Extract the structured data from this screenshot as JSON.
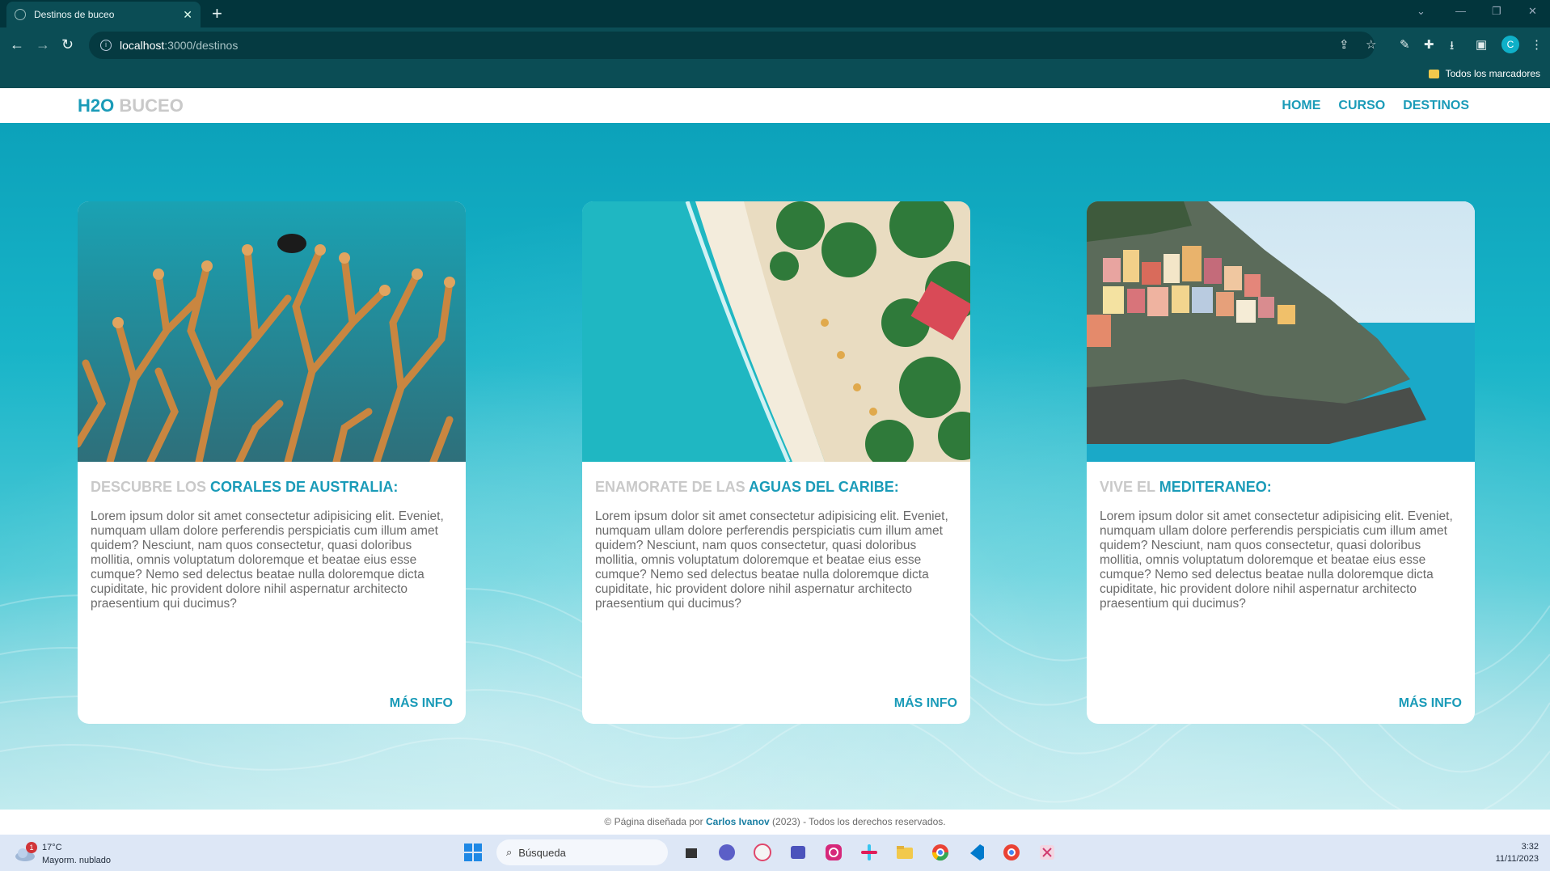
{
  "browser": {
    "tab_title": "Destinos de buceo",
    "new_tab": "+",
    "url_host": "localhost",
    "url_path": ":3000/destinos",
    "bookmarks_folder": "Todos los marcadores",
    "profile_initial": "C"
  },
  "site": {
    "logo_primary": "H2O",
    "logo_secondary": "BUCEO",
    "nav": [
      {
        "label": "HOME"
      },
      {
        "label": "CURSO"
      },
      {
        "label": "DESTINOS"
      }
    ],
    "cards": [
      {
        "heading_gray": "DESCUBRE LOS",
        "heading_teal": "CORALES DE AUSTRALIA:",
        "text": "Lorem ipsum dolor sit amet consectetur adipisicing elit. Eveniet, numquam ullam dolore perferendis perspiciatis cum illum amet quidem? Nesciunt, nam quos consectetur, quasi doloribus mollitia, omnis voluptatum doloremque et beatae eius esse cumque? Nemo sed delectus beatae nulla doloremque dicta cupiditate, hic provident dolore nihil aspernatur architecto praesentium qui ducimus?",
        "more": "MÁS INFO"
      },
      {
        "heading_gray": "ENAMORATE DE LAS",
        "heading_teal": "AGUAS DEL CARIBE:",
        "text": "Lorem ipsum dolor sit amet consectetur adipisicing elit. Eveniet, numquam ullam dolore perferendis perspiciatis cum illum amet quidem? Nesciunt, nam quos consectetur, quasi doloribus mollitia, omnis voluptatum doloremque et beatae eius esse cumque? Nemo sed delectus beatae nulla doloremque dicta cupiditate, hic provident dolore nihil aspernatur architecto praesentium qui ducimus?",
        "more": "MÁS INFO"
      },
      {
        "heading_gray": "VIVE EL",
        "heading_teal": "MEDITERANEO:",
        "text": "Lorem ipsum dolor sit amet consectetur adipisicing elit. Eveniet, numquam ullam dolore perferendis perspiciatis cum illum amet quidem? Nesciunt, nam quos consectetur, quasi doloribus mollitia, omnis voluptatum doloremque et beatae eius esse cumque? Nemo sed delectus beatae nulla doloremque dicta cupiditate, hic provident dolore nihil aspernatur architecto praesentium qui ducimus?",
        "more": "MÁS INFO"
      }
    ],
    "footer_prefix": "© Página diseñada por",
    "footer_author": "Carlos Ivanov",
    "footer_suffix": "(2023) - Todos los derechos reservados."
  },
  "taskbar": {
    "weather_temp": "17°C",
    "weather_desc": "Mayorm. nublado",
    "weather_badge": "1",
    "search_placeholder": "Búsqueda",
    "time": "3:32",
    "date": "11/11/2023"
  },
  "colors": {
    "accent": "#1a9bb8",
    "muted_heading": "#c9c9c9",
    "body_text": "#6b6b6b",
    "browser_chrome": "#0b4d55"
  }
}
